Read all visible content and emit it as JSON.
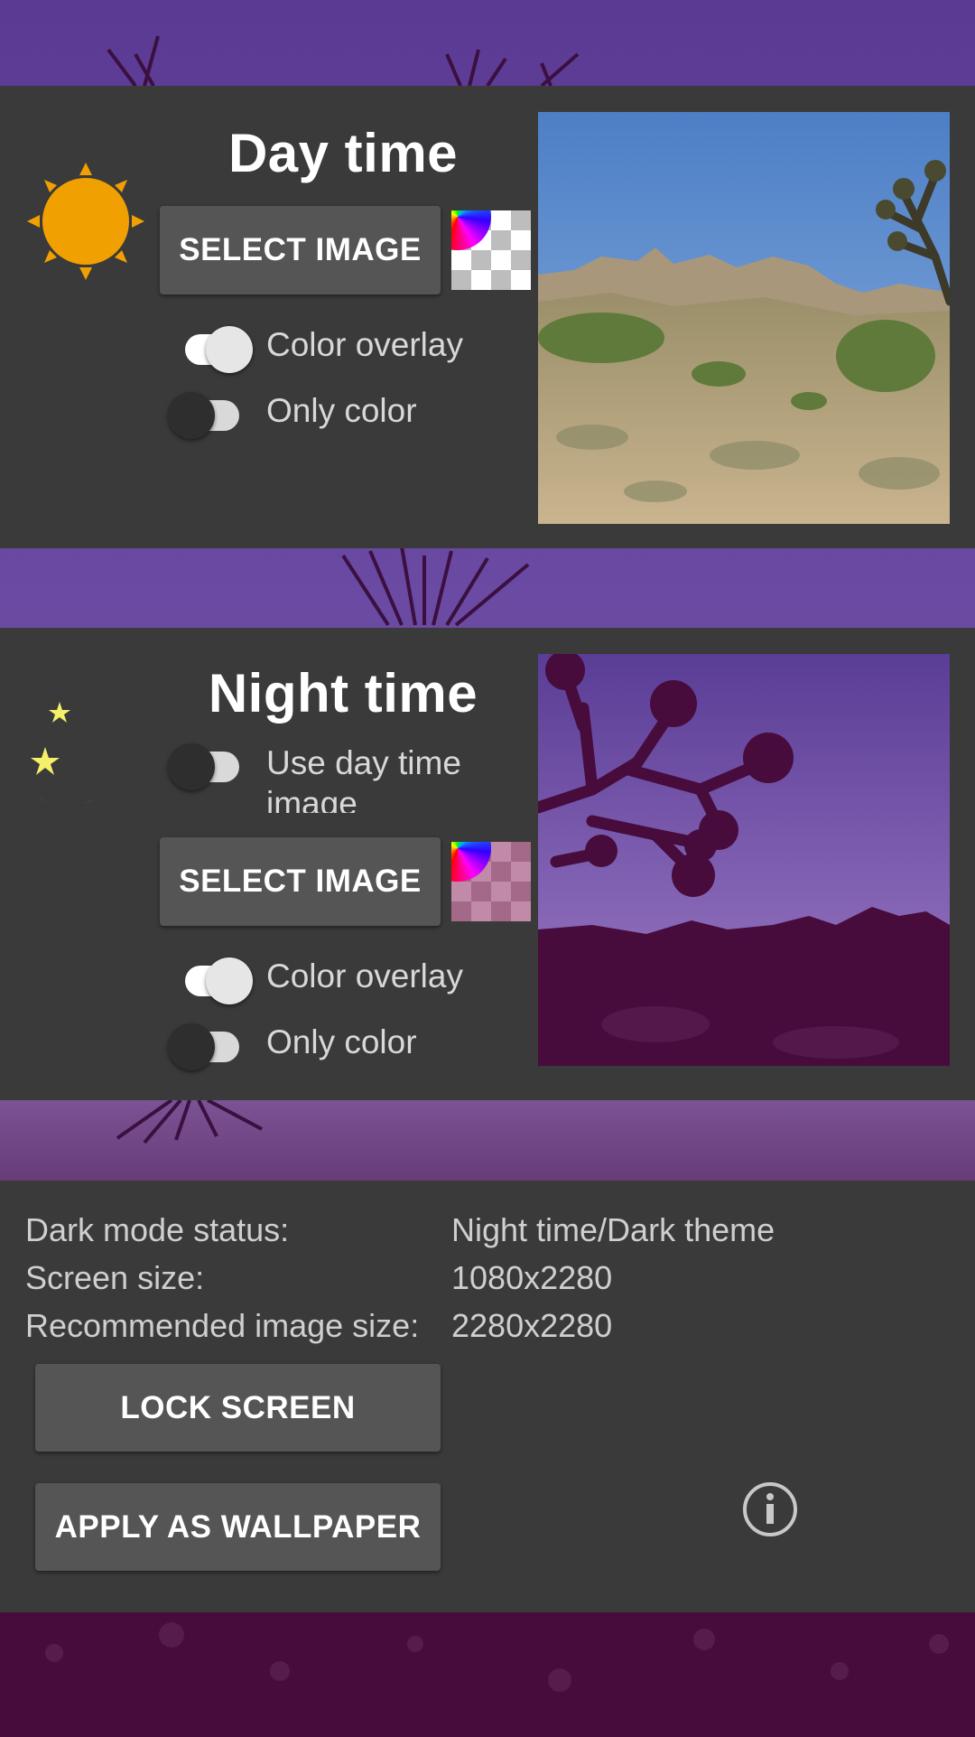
{
  "day": {
    "title": "Day time",
    "select_image_label": "SELECT IMAGE",
    "color_overlay_label": "Color overlay",
    "color_overlay_on": true,
    "only_color_label": "Only color",
    "only_color_on": false
  },
  "night": {
    "title": "Night time",
    "use_day_image_label": "Use day time image",
    "use_day_image_on": false,
    "select_image_label": "SELECT IMAGE",
    "color_overlay_label": "Color overlay",
    "color_overlay_on": true,
    "only_color_label": "Only color",
    "only_color_on": false
  },
  "info": {
    "dark_mode_label": "Dark mode status:",
    "dark_mode_value": "Night time/Dark theme",
    "screen_size_label": "Screen size:",
    "screen_size_value": "1080x2280",
    "recommended_label": "Recommended image size:",
    "recommended_value": "2280x2280"
  },
  "actions": {
    "lock_screen_label": "LOCK SCREEN",
    "apply_wallpaper_label": "APPLY AS WALLPAPER"
  },
  "icons": {
    "day": "sun-icon",
    "night": "moon-icon",
    "color_picker": "color-picker-icon",
    "info": "info-icon"
  },
  "colors": {
    "panel": "#3a3a3a",
    "button": "#555555",
    "sun": "#f0a000",
    "moon": "#8e8e8e",
    "star": "#f5f06a"
  }
}
